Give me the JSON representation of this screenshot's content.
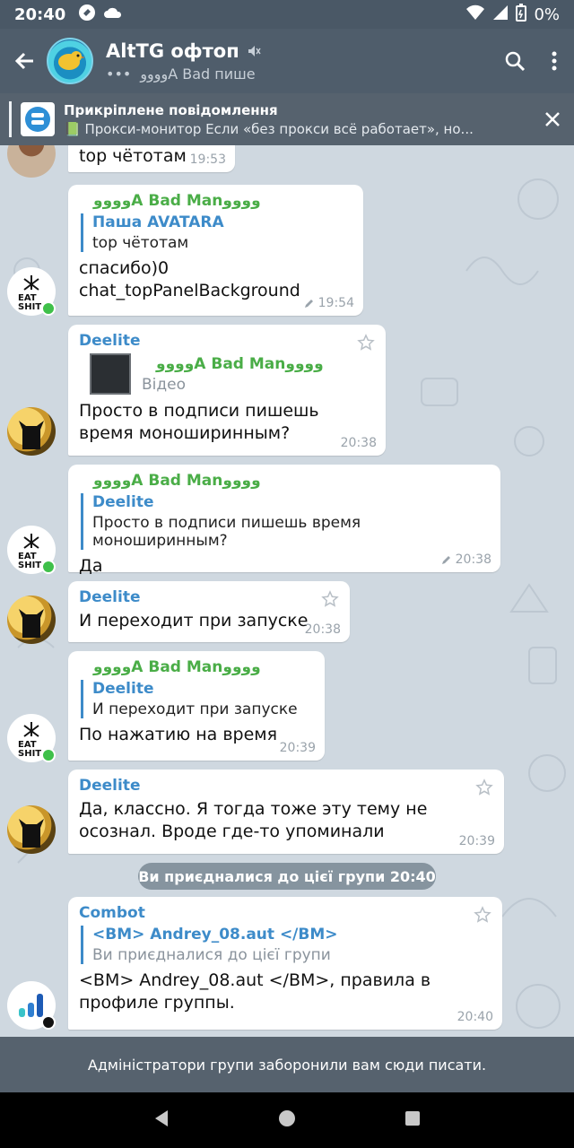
{
  "status_bar": {
    "time": "20:40",
    "battery": "0%"
  },
  "header": {
    "title": "AltTG офтоп",
    "typing_dots": "•••",
    "subtitle": "ﻭﻭﻭﻭA Bad пише"
  },
  "pinned": {
    "title": "Прикріплене повідомлення",
    "emoji": "📗",
    "message": "Прокси-монитор   Если «без прокси всё работает», но..."
  },
  "messages": [
    {
      "text": "top чётотам",
      "time": "19:53"
    },
    {
      "sender": "ﻭﻭﻭﻭA Bad Manﻭﻭﻭﻭ",
      "reply_name": "Паша AVATARA",
      "reply_text": "top чётотам",
      "text_line1": "спасибо)0",
      "text_line2": "chat_topPanelBackground",
      "time": "19:54"
    },
    {
      "sender": "Deelite",
      "reply_name": "ﻭﻭﻭﻭA Bad Manﻭﻭﻭﻭ",
      "reply_text": "Відео",
      "text": "Просто в подписи пишешь время моноширинным?",
      "time": "20:38"
    },
    {
      "sender": "ﻭﻭﻭﻭA Bad Manﻭﻭﻭﻭ",
      "reply_name": "Deelite",
      "reply_text": "Просто в подписи пишешь время моноширинным?",
      "text": "Да",
      "time": "20:38"
    },
    {
      "sender": "Deelite",
      "text": "И переходит при запуске",
      "time": "20:38"
    },
    {
      "sender": "ﻭﻭﻭﻭA Bad Manﻭﻭﻭﻭ",
      "reply_name": "Deelite",
      "reply_text": "И переходит при запуске",
      "text": "По нажатию на время",
      "time": "20:39"
    },
    {
      "sender": "Deelite",
      "text": "Да, классно. Я тогда тоже эту тему не осознал. Вроде где-то упоминали",
      "time": "20:39"
    },
    {
      "sender": "Combot",
      "reply_name": "<BM> Andrey_08.aut </BM>",
      "reply_text": "Ви приєдналися до цієї групи",
      "text": "<BM> Andrey_08.aut </BM>, правила в профиле группы.",
      "time": "20:40"
    }
  ],
  "service": {
    "text": "Ви приєдналися до цієї групи  20:40"
  },
  "bottom_notice": "Адміністратори групи заборонили вам сюди писати.",
  "colors": {
    "header": "#4f5d6b",
    "name_green": "#4aad47",
    "name_blue": "#3d8bc9",
    "online": "#3fc04a"
  }
}
